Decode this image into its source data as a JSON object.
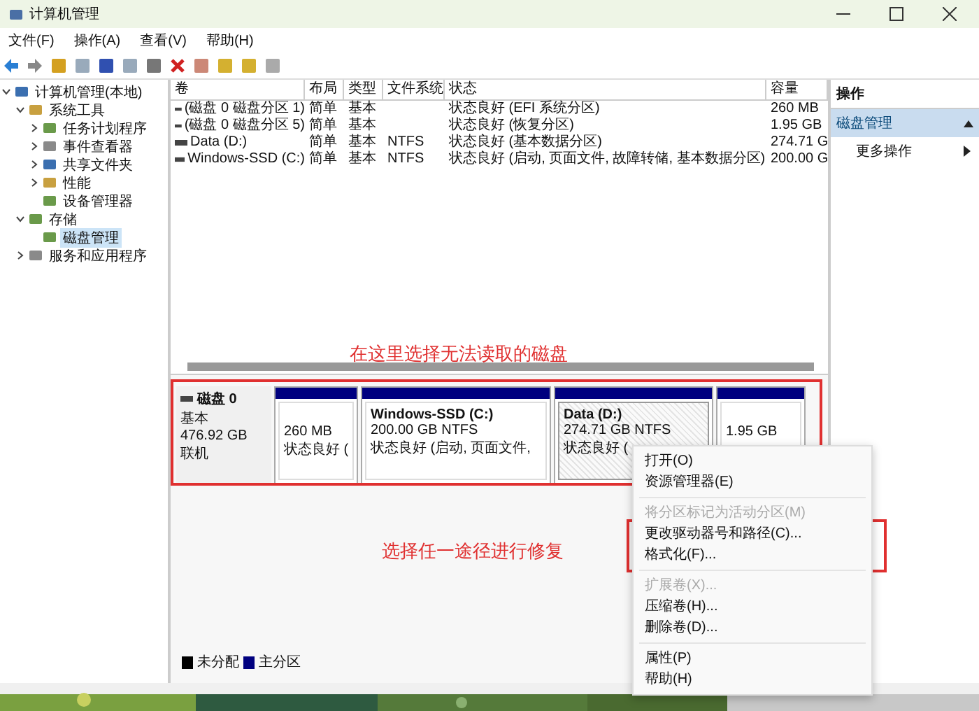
{
  "window": {
    "title": "计算机管理"
  },
  "menu": [
    "文件(F)",
    "操作(A)",
    "查看(V)",
    "帮助(H)"
  ],
  "tree": [
    {
      "label": "计算机管理(本地)",
      "expanded": true,
      "selected": false,
      "children": [
        {
          "label": "系统工具",
          "expanded": true,
          "selected": false,
          "children": [
            {
              "label": "任务计划程序",
              "expanded": false,
              "selected": false
            },
            {
              "label": "事件查看器",
              "expanded": false,
              "selected": false
            },
            {
              "label": "共享文件夹",
              "expanded": false,
              "selected": false
            },
            {
              "label": "性能",
              "expanded": false,
              "selected": false
            },
            {
              "label": "设备管理器",
              "selected": false
            }
          ]
        },
        {
          "label": "存储",
          "expanded": true,
          "selected": false,
          "children": [
            {
              "label": "磁盘管理",
              "selected": true
            }
          ]
        },
        {
          "label": "服务和应用程序",
          "expanded": false,
          "selected": false
        }
      ]
    }
  ],
  "table": {
    "columns": [
      "卷",
      "布局",
      "类型",
      "文件系统",
      "状态",
      "容量"
    ],
    "rows": [
      [
        "(磁盘 0 磁盘分区 1)",
        "简单",
        "基本",
        "",
        "状态良好 (EFI 系统分区)",
        "260 MB"
      ],
      [
        "(磁盘 0 磁盘分区 5)",
        "简单",
        "基本",
        "",
        "状态良好 (恢复分区)",
        "1.95 GB"
      ],
      [
        "Data (D:)",
        "简单",
        "基本",
        "NTFS",
        "状态良好 (基本数据分区)",
        "274.71 G"
      ],
      [
        "Windows-SSD (C:)",
        "简单",
        "基本",
        "NTFS",
        "状态良好 (启动, 页面文件, 故障转储, 基本数据分区)",
        "200.00 G"
      ]
    ]
  },
  "disk": {
    "name": "磁盘 0",
    "type": "基本",
    "size": "476.92 GB",
    "status": "联机",
    "partitions": [
      {
        "size": "260 MB",
        "status": "状态良好 (",
        "selected": false
      },
      {
        "name": "Windows-SSD  (C:)",
        "size": "200.00 GB NTFS",
        "status": "状态良好 (启动, 页面文件,",
        "selected": false
      },
      {
        "name": "Data  (D:)",
        "size": "274.71 GB NTFS",
        "status": "状态良好 (",
        "selected": true
      },
      {
        "size": "1.95 GB",
        "selected": false
      }
    ]
  },
  "legend": [
    {
      "label": "未分配",
      "color": "#000000"
    },
    {
      "label": "主分区",
      "color": "#00007f"
    }
  ],
  "actions": {
    "title": "操作",
    "section": "磁盘管理",
    "items": [
      "更多操作"
    ]
  },
  "context_menu": [
    {
      "label": "打开(O)",
      "disabled": false
    },
    {
      "label": "资源管理器(E)",
      "disabled": false
    },
    {
      "kind": "separator"
    },
    {
      "label": "将分区标记为活动分区(M)",
      "disabled": true
    },
    {
      "label": "更改驱动器号和路径(C)...",
      "disabled": false
    },
    {
      "label": "格式化(F)...",
      "disabled": false
    },
    {
      "kind": "separator"
    },
    {
      "label": "扩展卷(X)...",
      "disabled": true
    },
    {
      "label": "压缩卷(H)...",
      "disabled": false
    },
    {
      "label": "删除卷(D)...",
      "disabled": false
    },
    {
      "kind": "separator"
    },
    {
      "label": "属性(P)",
      "disabled": false
    },
    {
      "label": "帮助(H)",
      "disabled": false
    }
  ],
  "annotations": [
    "在这里选择无法读取的磁盘",
    "选择任一途径进行修复"
  ]
}
